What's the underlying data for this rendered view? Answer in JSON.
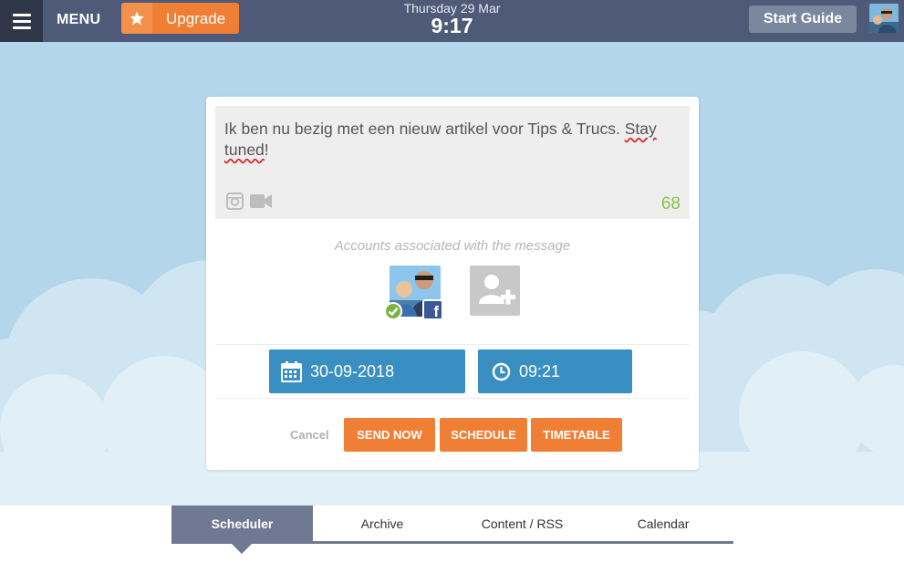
{
  "topbar": {
    "menu_label": "MENU",
    "upgrade_label": "Upgrade",
    "date": "Thursday 29 Mar",
    "time": "9:17",
    "start_guide_label": "Start Guide",
    "icons": [
      "hamburger-icon",
      "star-icon",
      "user-avatar"
    ]
  },
  "composer": {
    "message_before": "Ik ben nu bezig met een nieuw artikel voor Tips & Trucs. ",
    "message_word_flagged_1": "Stay",
    "message_space": " ",
    "message_word_flagged_2": "tuned",
    "message_after": "!",
    "char_count": "68",
    "icons": [
      "instagram-icon",
      "video-camera-icon"
    ]
  },
  "accounts": {
    "label": "Accounts associated with the message",
    "selected_network": "facebook",
    "icons": [
      "facebook-badge-icon",
      "check-icon",
      "add-user-icon"
    ]
  },
  "schedule": {
    "date": "30-09-2018",
    "time": "09:21",
    "icons": [
      "calendar-icon",
      "clock-icon"
    ]
  },
  "actions": {
    "cancel": "Cancel",
    "send_now": "SEND NOW",
    "schedule": "SCHEDULE",
    "timetable": "TIMETABLE"
  },
  "tabs": [
    {
      "label": "Scheduler",
      "active": true
    },
    {
      "label": "Archive",
      "active": false
    },
    {
      "label": "Content / RSS",
      "active": false
    },
    {
      "label": "Calendar",
      "active": false
    }
  ],
  "colors": {
    "topbar": "#4e5a78",
    "accent_orange": "#f07f36",
    "accent_blue": "#3a8fc2",
    "sky": "#b3d6ea",
    "count_green": "#8bc34a"
  }
}
